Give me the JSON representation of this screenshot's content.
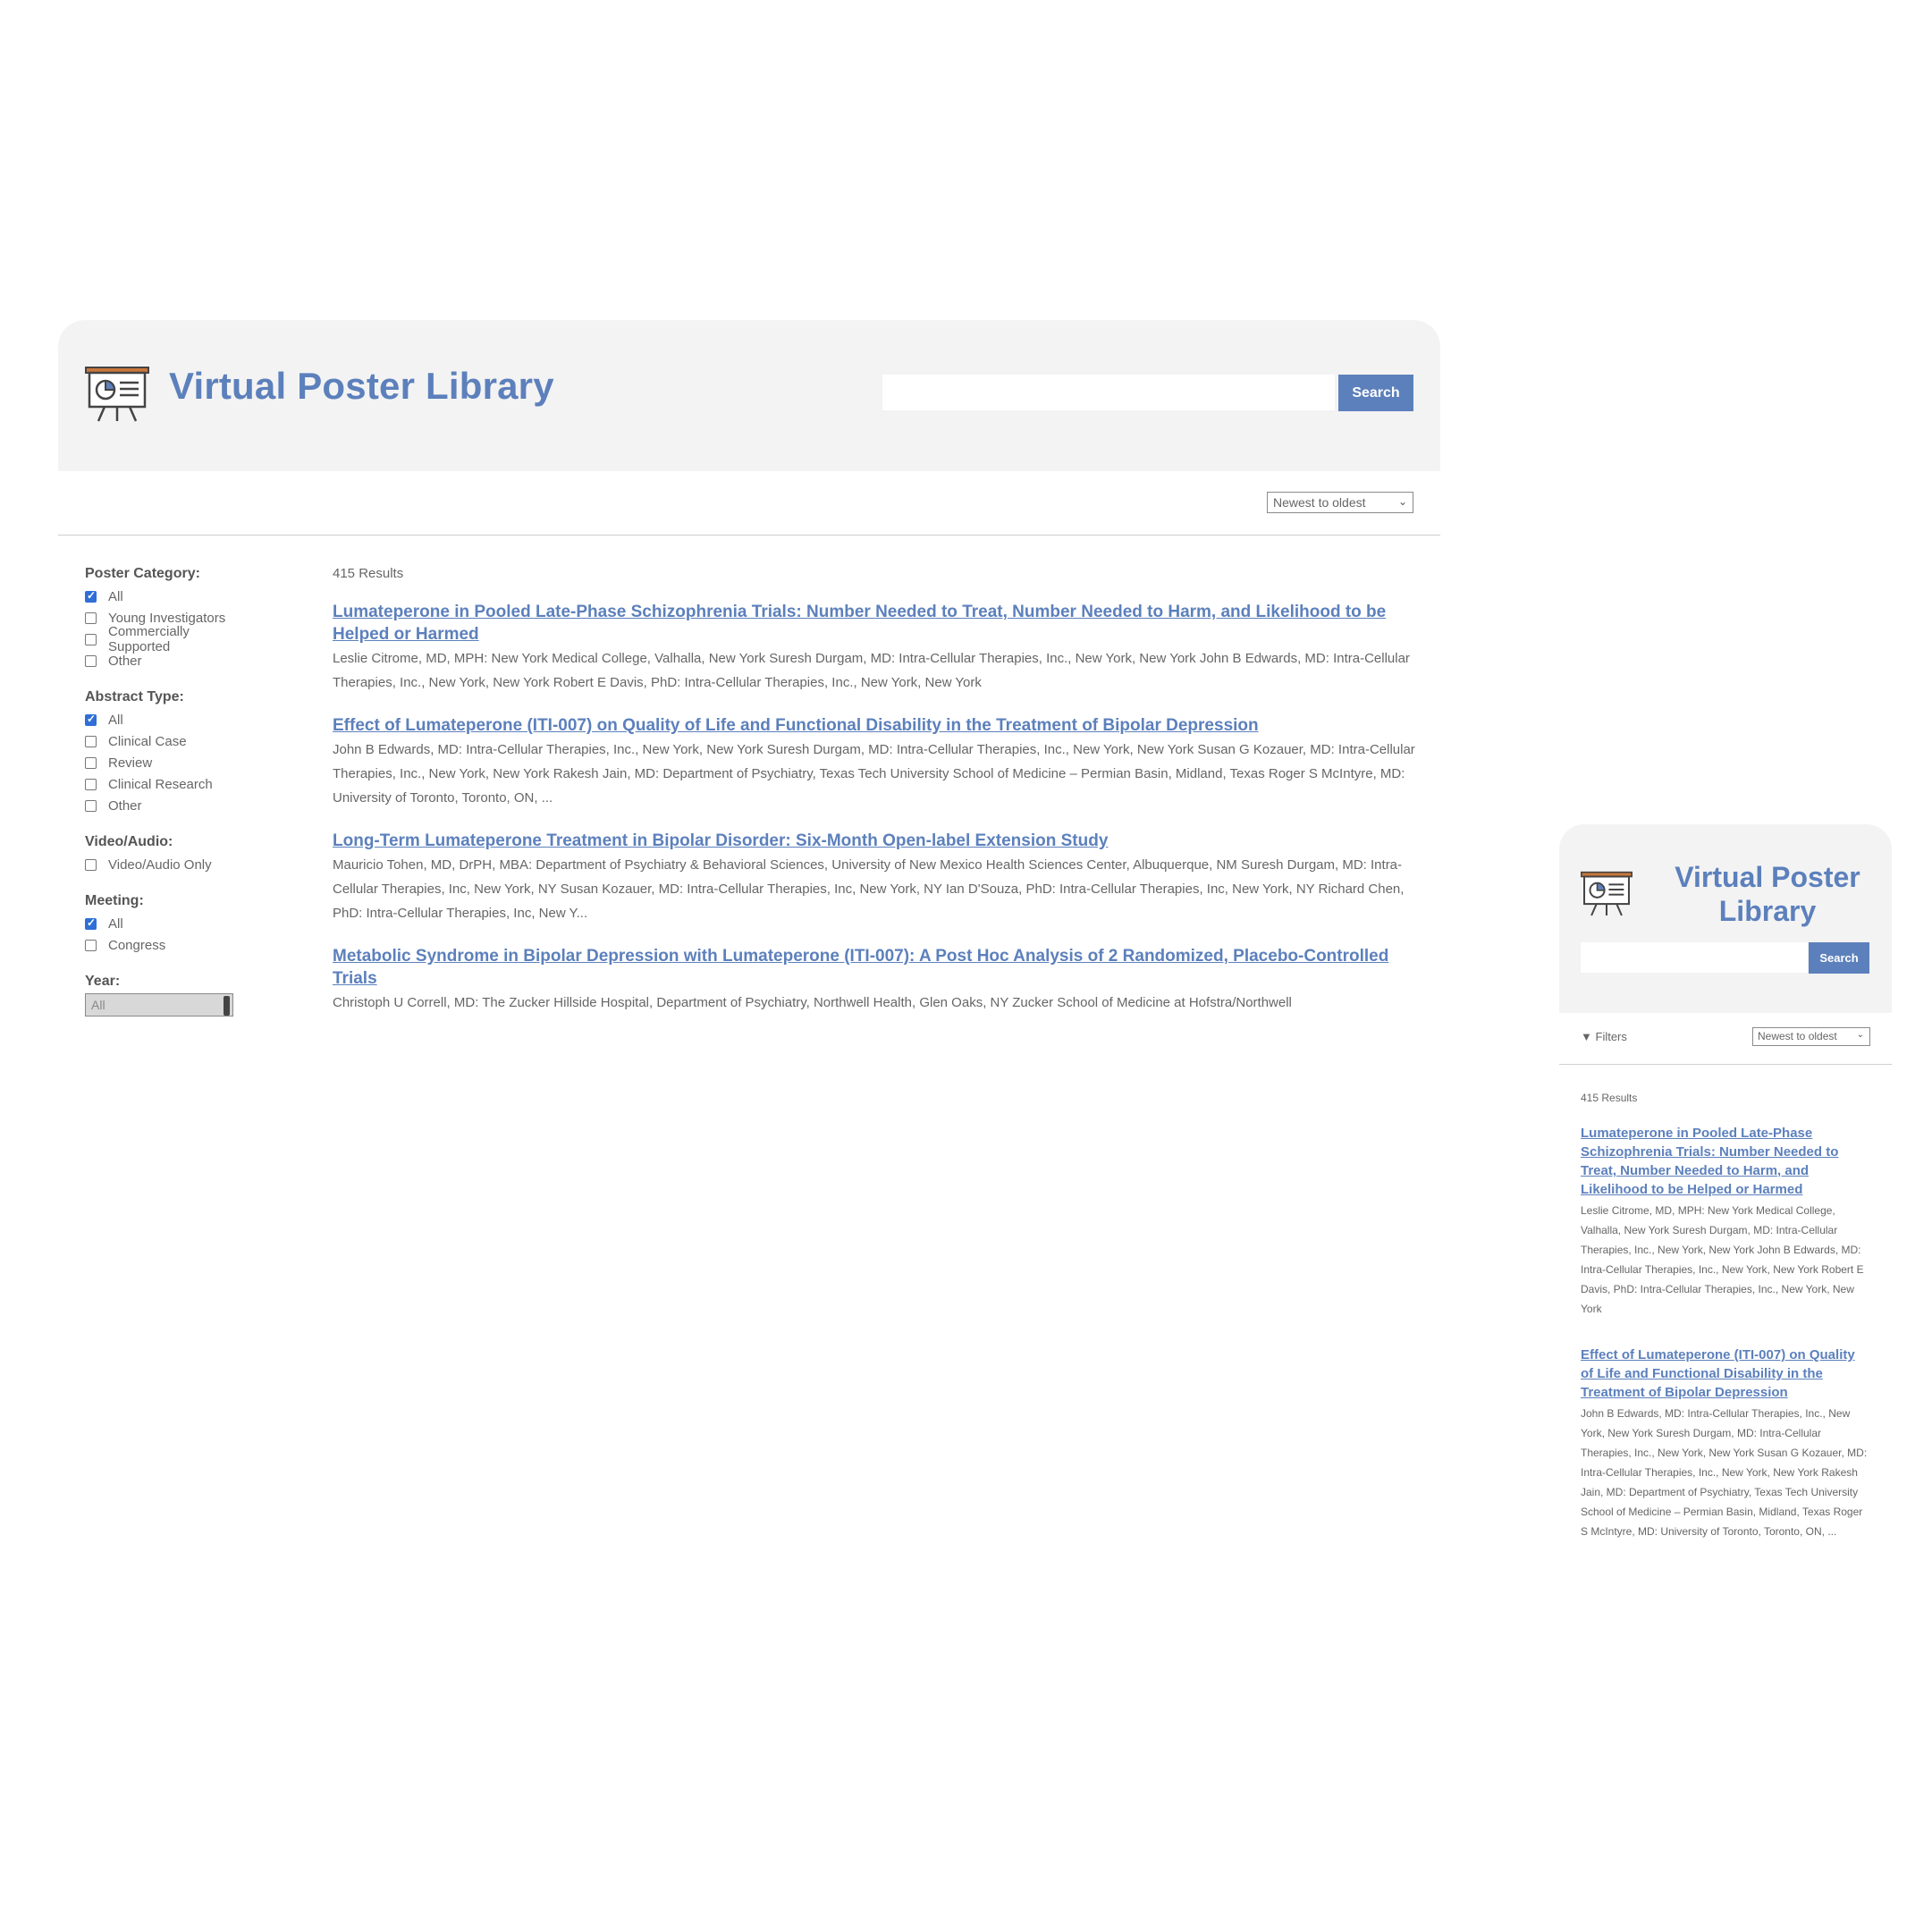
{
  "app": {
    "title": "Virtual Poster Library",
    "search_placeholder": "",
    "search_button": "Search",
    "sort_selected": "Newest to oldest",
    "filters_label": "Filters",
    "results_count": "415 Results",
    "accent_color": "#5c80bc"
  },
  "filters": [
    {
      "heading": "Poster Category:",
      "options": [
        {
          "label": "All",
          "checked": true
        },
        {
          "label": "Young Investigators",
          "checked": false
        },
        {
          "label": "Commercially Supported",
          "checked": false
        },
        {
          "label": "Other",
          "checked": false
        }
      ]
    },
    {
      "heading": "Abstract Type:",
      "options": [
        {
          "label": "All",
          "checked": true
        },
        {
          "label": "Clinical Case",
          "checked": false
        },
        {
          "label": "Review",
          "checked": false
        },
        {
          "label": "Clinical Research",
          "checked": false
        },
        {
          "label": "Other",
          "checked": false
        }
      ]
    },
    {
      "heading": "Video/Audio:",
      "options": [
        {
          "label": "Video/Audio Only",
          "checked": false
        }
      ]
    },
    {
      "heading": "Meeting:",
      "options": [
        {
          "label": "All",
          "checked": true
        },
        {
          "label": "Congress",
          "checked": false
        }
      ]
    }
  ],
  "year_filter": {
    "heading": "Year:",
    "selected": "All"
  },
  "results": [
    {
      "title": "Lumateperone in Pooled Late-Phase Schizophrenia Trials: Number Needed to Treat, Number Needed to Harm, and Likelihood to be Helped or Harmed",
      "authors": "Leslie Citrome, MD, MPH: New York Medical College, Valhalla, New York Suresh Durgam, MD: Intra-Cellular Therapies, Inc., New York, New York John B Edwards, MD: Intra-Cellular Therapies, Inc., New York, New York Robert E Davis, PhD: Intra-Cellular Therapies, Inc., New York, New York"
    },
    {
      "title": "Effect of Lumateperone (ITI-007) on Quality of Life and Functional Disability in the Treatment of Bipolar Depression",
      "authors": "John B Edwards, MD: Intra-Cellular Therapies, Inc., New York, New York Suresh Durgam, MD: Intra-Cellular Therapies, Inc., New York, New York Susan G Kozauer, MD: Intra-Cellular Therapies, Inc., New York, New York Rakesh Jain, MD: Department of Psychiatry, Texas Tech University School of Medicine – Permian Basin, Midland, Texas Roger S McIntyre, MD: University of Toronto, Toronto, ON, ..."
    },
    {
      "title": "Long-Term Lumateperone Treatment in Bipolar Disorder: Six-Month Open-label Extension Study",
      "authors": "Mauricio Tohen, MD, DrPH, MBA: Department of Psychiatry & Behavioral Sciences, University of New Mexico Health Sciences Center, Albuquerque, NM Suresh Durgam, MD: Intra-Cellular Therapies, Inc, New York, NY Susan Kozauer, MD: Intra-Cellular Therapies, Inc, New York, NY Ian D'Souza, PhD: Intra-Cellular Therapies, Inc, New York, NY Richard Chen, PhD: Intra-Cellular Therapies, Inc, New Y..."
    },
    {
      "title": "Metabolic Syndrome in Bipolar Depression with Lumateperone (ITI-007): A Post Hoc Analysis of 2 Randomized, Placebo-Controlled Trials",
      "authors": "Christoph U Correll, MD: The Zucker Hillside Hospital, Department of Psychiatry, Northwell Health, Glen Oaks, NY Zucker School of Medicine at Hofstra/Northwell"
    }
  ]
}
